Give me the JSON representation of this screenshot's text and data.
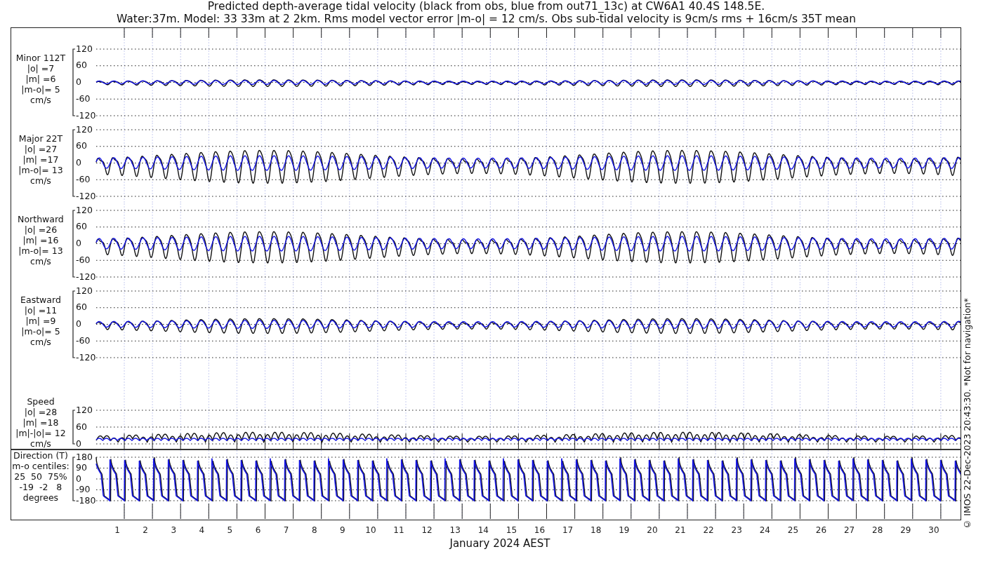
{
  "title": [
    "Predicted depth-average tidal velocity (black from obs, blue from out71_13c) at CW6A1 40.4S 148.5E.",
    "Water:37m. Model: 33 33m at 2 2km. Rms model vector error |m-o| = 12 cm/s. Obs sub-tidal velocity is 9cm/s rms + 16cm/s 35T mean"
  ],
  "panels": [
    {
      "kind": "signed",
      "label": [
        "Minor 112T",
        "|o| =7",
        "|m| =6",
        "|m-o|= 5",
        "cm/s"
      ],
      "yticks": [
        "120",
        "60",
        "0",
        "-60",
        "-120"
      ]
    },
    {
      "kind": "signed",
      "label": [
        "Major 22T",
        "|o| =27",
        "|m| =17",
        "|m-o|= 13",
        "cm/s"
      ],
      "yticks": [
        "120",
        "60",
        "0",
        "-60",
        "-120"
      ]
    },
    {
      "kind": "signed",
      "label": [
        "Northward",
        "|o| =26",
        "|m| =16",
        "|m-o|= 13",
        "cm/s"
      ],
      "yticks": [
        "120",
        "60",
        "0",
        "-60",
        "-120"
      ]
    },
    {
      "kind": "signed",
      "label": [
        "Eastward",
        "|o| =11",
        "|m| =9",
        "|m-o|= 5",
        "cm/s"
      ],
      "yticks": [
        "120",
        "60",
        "0",
        "-60",
        "-120"
      ]
    },
    {
      "kind": "speed",
      "label": [
        "Speed",
        "|o| =28",
        "|m| =18",
        "|m|-|o|= 12",
        "cm/s"
      ],
      "yticks": [
        "120",
        "60",
        "0"
      ]
    }
  ],
  "direction": {
    "kind": "direction",
    "label": [
      "Direction (T)",
      "m-o centiles:",
      "25  50  75%",
      "-19  -2   8",
      "degrees"
    ],
    "yticks": [
      "180",
      "90",
      "0",
      "-90",
      "-180"
    ]
  },
  "days": [
    "1",
    "2",
    "3",
    "4",
    "5",
    "6",
    "7",
    "8",
    "9",
    "10",
    "11",
    "12",
    "13",
    "14",
    "15",
    "16",
    "17",
    "18",
    "19",
    "20",
    "21",
    "22",
    "23",
    "24",
    "25",
    "26",
    "27",
    "28",
    "29",
    "30"
  ],
  "xlabel": "January 2024 AEST",
  "credit": "© IMOS 22-Dec-2023 20:43:30.  *Not for navigation*"
}
